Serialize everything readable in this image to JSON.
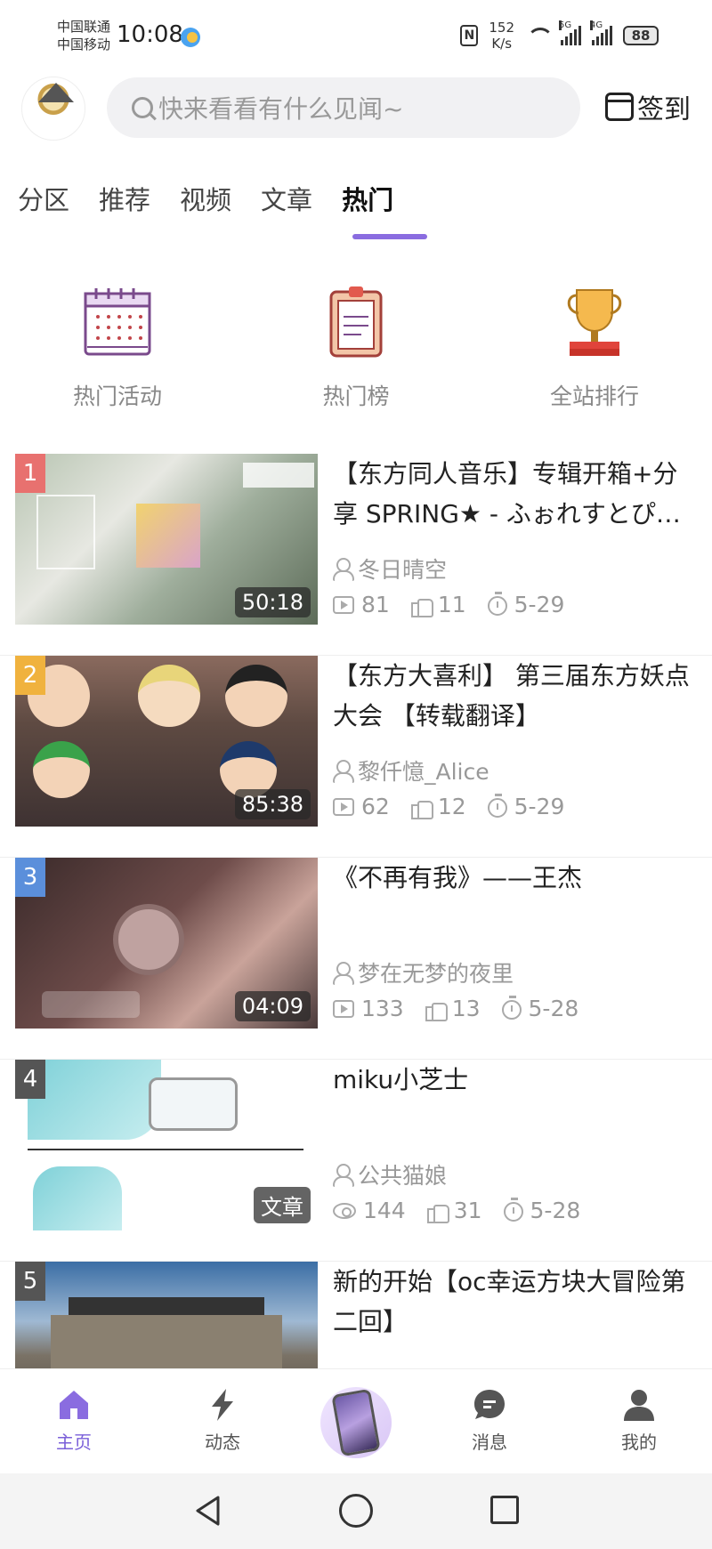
{
  "status_bar": {
    "carrier_1": "中国联通",
    "carrier_2": "中国移动",
    "time": "10:08",
    "net_speed_value": "152",
    "net_speed_unit": "K/s",
    "signal_1_label": "5G",
    "signal_2_label": "4G",
    "battery": "88"
  },
  "header": {
    "search_placeholder": "快来看看有什么见闻~",
    "checkin_label": "签到"
  },
  "tabs": [
    {
      "label": "分区"
    },
    {
      "label": "推荐"
    },
    {
      "label": "视频"
    },
    {
      "label": "文章"
    },
    {
      "label": "热门",
      "active": true
    }
  ],
  "quick_entries": [
    {
      "label": "热门活动",
      "icon": "calendar-icon"
    },
    {
      "label": "热门榜",
      "icon": "clipboard-icon"
    },
    {
      "label": "全站排行",
      "icon": "trophy-icon"
    }
  ],
  "items": [
    {
      "rank": "1",
      "rank_color": "#e8716f",
      "title": "【东方同人音乐】专辑开箱+分享 SPRING★ - ふぉれすとぴ…",
      "author": "冬日晴空",
      "views": "81",
      "likes": "11",
      "date": "5-29",
      "duration": "50:18",
      "view_icon": "play-icon"
    },
    {
      "rank": "2",
      "rank_color": "#f0b23e",
      "title": "【东方大喜利】 第三届东方妖点大会 【转载翻译】",
      "author": "黎仟憶_Alice",
      "views": "62",
      "likes": "12",
      "date": "5-29",
      "duration": "85:38",
      "view_icon": "play-icon"
    },
    {
      "rank": "3",
      "rank_color": "#5b8fdb",
      "title": "《不再有我》——王杰",
      "author": "梦在无梦的夜里",
      "views": "133",
      "likes": "13",
      "date": "5-28",
      "duration": "04:09",
      "view_icon": "play-icon"
    },
    {
      "rank": "4",
      "rank_color": "#555555",
      "title": "miku小芝士",
      "author": "公共猫娘",
      "views": "144",
      "likes": "31",
      "date": "5-28",
      "duration": "文章",
      "view_icon": "eye-icon"
    },
    {
      "rank": "5",
      "rank_color": "#555555",
      "title": "新的开始【oc幸运方块大冒险第二回】",
      "author": "",
      "views": "",
      "likes": "",
      "date": "",
      "duration": "",
      "view_icon": "play-icon"
    }
  ],
  "bottom_nav": [
    {
      "label": "主页",
      "icon": "home-icon",
      "active": true
    },
    {
      "label": "动态",
      "icon": "lightning-icon"
    },
    {
      "label": "",
      "icon": "publish-icon"
    },
    {
      "label": "消息",
      "icon": "message-icon"
    },
    {
      "label": "我的",
      "icon": "profile-icon"
    }
  ],
  "colors": {
    "accent": "#8a6ce0"
  }
}
